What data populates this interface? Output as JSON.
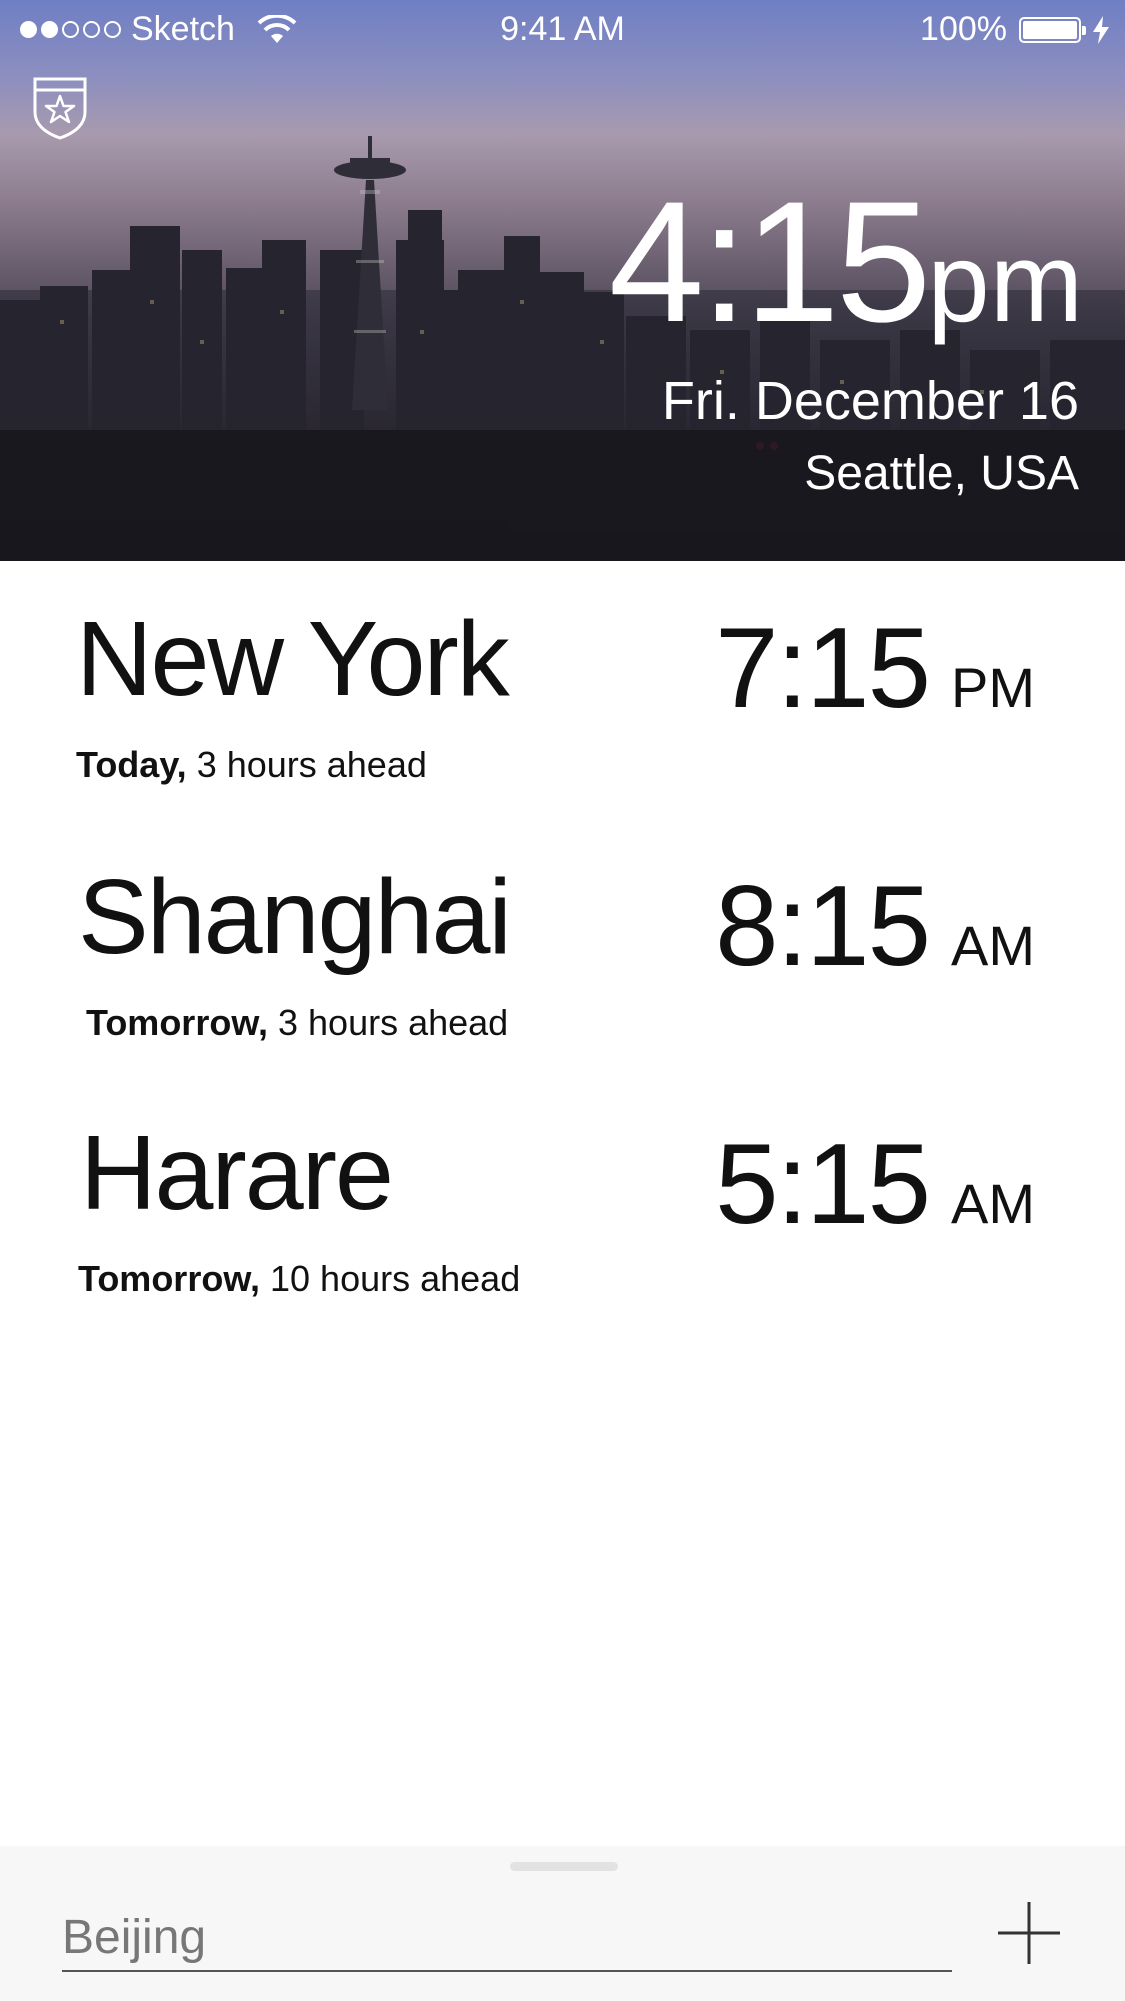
{
  "status_bar": {
    "carrier": "Sketch",
    "signal_dots_filled": 2,
    "signal_dots_total": 5,
    "time": "9:41 AM",
    "battery_percent": "100%"
  },
  "hero": {
    "badge_icon": "shield-star-icon",
    "local_time": "4:15",
    "local_ampm": "pm",
    "local_date": "Fri. December 16",
    "local_place": "Seattle, USA"
  },
  "cities": [
    {
      "name": "New York",
      "day": "Today,",
      "offset": "3 hours ahead",
      "time": "7:15",
      "ampm": "PM"
    },
    {
      "name": "Shanghai",
      "day": "Tomorrow,",
      "offset": "3 hours ahead",
      "time": "8:15",
      "ampm": "AM"
    },
    {
      "name": "Harare",
      "day": "Tomorrow,",
      "offset": "10 hours ahead",
      "time": "5:15",
      "ampm": "AM"
    }
  ],
  "add_city": {
    "value": "Beijing",
    "add_icon": "plus-icon"
  },
  "colors": {
    "hero_top": "#6f7fc4",
    "hero_bottom": "#141318",
    "text": "#111111",
    "bottom_bar": "#f7f7f7"
  }
}
